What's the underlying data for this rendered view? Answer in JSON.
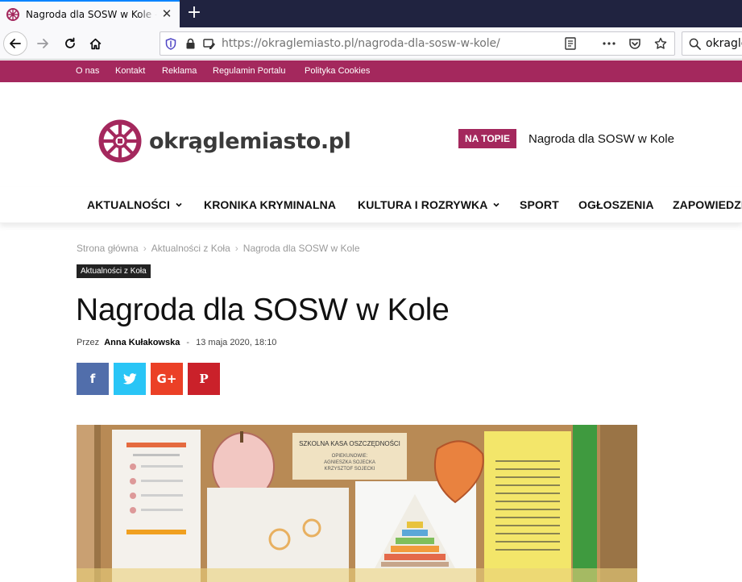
{
  "browser": {
    "tab_title": "Nagroda dla SOSW w Kole - Okrągłemiasto.pl",
    "url_domain": "https://okraglemiasto.pl",
    "url_path": "/nagroda-dla-sosw-w-kole/",
    "search_text": "okragle",
    "icons": [
      "back-icon",
      "forward-icon",
      "reload-icon",
      "home-icon",
      "shield-icon",
      "lock-icon",
      "reader-icon",
      "more-icon",
      "pocket-icon",
      "star-icon",
      "search-icon"
    ]
  },
  "topbar": {
    "links": [
      "O nas",
      "Kontakt",
      "Reklama",
      "Regulamin Portalu",
      "Polityka Cookies"
    ]
  },
  "header": {
    "logo_text": "okrąglemiasto.pl",
    "hot_label": "NA TOPIE",
    "hot_title": "Nagroda dla SOSW w Kole"
  },
  "mainnav": {
    "items": [
      "AKTUALNOŚCI",
      "KRONIKA KRYMINALNA",
      "KULTURA I ROZRYWKA",
      "SPORT",
      "OGŁOSZENIA",
      "ZAPOWIEDZI"
    ]
  },
  "article": {
    "breadcrumb": [
      "Strona główna",
      "Aktualności z Koła",
      "Nagroda dla SOSW w Kole"
    ],
    "category": "Aktualności z Koła",
    "title": "Nagroda dla SOSW w Kole",
    "by_label": "Przez",
    "author": "Anna Kułakowska",
    "date": "13 maja 2020, 18:10",
    "share": [
      "f",
      "G+",
      "P"
    ]
  },
  "photo": {
    "board_title": "SZKOLNA KASA OSZCZĘDNOŚCI",
    "board_sub1": "OPIEKUNOWIE:",
    "board_sub2": "AGNIESZKA SOJECKA",
    "board_sub3": "KRZYSZTOF SOJECKI"
  },
  "colors": {
    "brand": "#a4285d",
    "facebook": "#516eab",
    "twitter": "#29c5f6",
    "googleplus": "#eb4026",
    "pinterest": "#ca212a"
  }
}
